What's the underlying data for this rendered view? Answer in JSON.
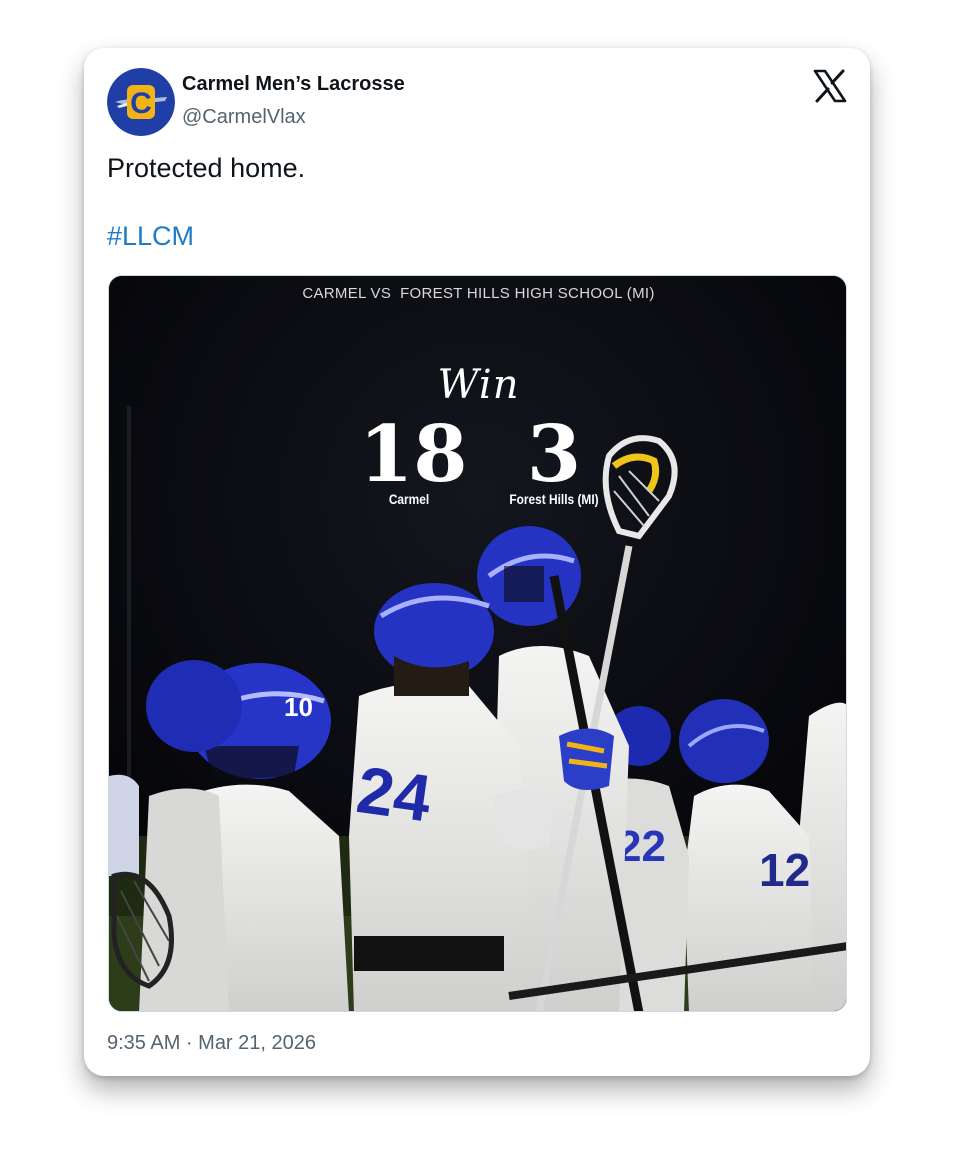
{
  "tweet": {
    "author": {
      "display_name": "Carmel Men’s Lacrosse",
      "handle": "@CarmelVlax",
      "avatar_letter": "C"
    },
    "text": "Protected home.",
    "hashtag": "#LLCM",
    "timestamp": "9:35 AM · Mar 21, 2026",
    "brand_icon": "x-logo-icon"
  },
  "media": {
    "matchup": "CARMEL VS  FOREST HILLS HIGH SCHOOL (MI)",
    "result": "Win",
    "home": {
      "score": "18",
      "team": "Carmel"
    },
    "away": {
      "score": "3",
      "team": "Forest Hills (MI)"
    },
    "jersey_numbers": [
      "10",
      "24",
      "22",
      "12"
    ]
  },
  "colors": {
    "link": "#1d7bc8",
    "avatar_blue": "#1f3fa6",
    "avatar_gold": "#f2b316",
    "helmet_blue": "#2230b8"
  }
}
